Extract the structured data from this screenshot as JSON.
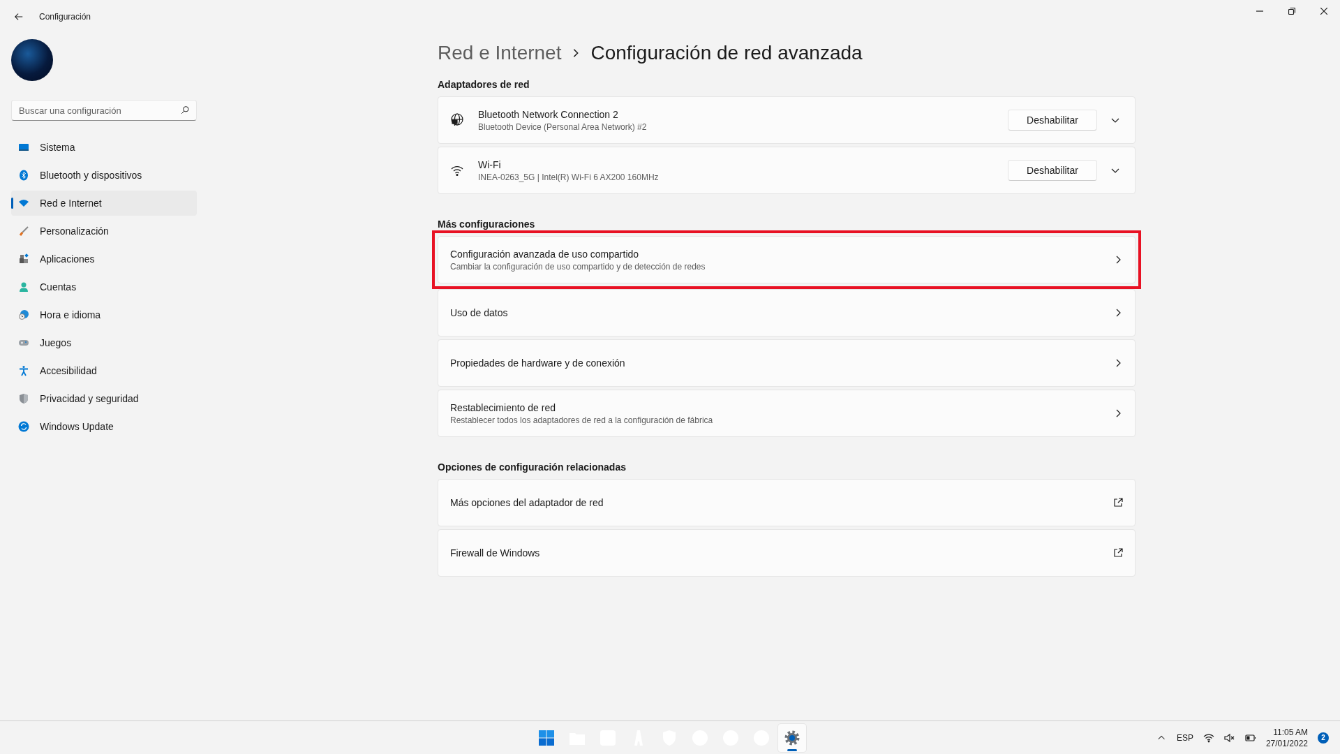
{
  "window": {
    "title": "Configuración"
  },
  "search": {
    "placeholder": "Buscar una configuración"
  },
  "nav": [
    {
      "kind": "system",
      "label": "Sistema",
      "selected": false
    },
    {
      "kind": "bluetooth",
      "label": "Bluetooth y dispositivos",
      "selected": false
    },
    {
      "kind": "network",
      "label": "Red e Internet",
      "selected": true
    },
    {
      "kind": "brush",
      "label": "Personalización",
      "selected": false
    },
    {
      "kind": "apps",
      "label": "Aplicaciones",
      "selected": false
    },
    {
      "kind": "accounts",
      "label": "Cuentas",
      "selected": false
    },
    {
      "kind": "time",
      "label": "Hora e idioma",
      "selected": false
    },
    {
      "kind": "games",
      "label": "Juegos",
      "selected": false
    },
    {
      "kind": "accessibility",
      "label": "Accesibilidad",
      "selected": false
    },
    {
      "kind": "privacy",
      "label": "Privacidad y seguridad",
      "selected": false
    },
    {
      "kind": "update",
      "label": "Windows Update",
      "selected": false
    }
  ],
  "breadcrumb": {
    "parent": "Red e Internet",
    "current": "Configuración de red avanzada"
  },
  "adapters": {
    "title": "Adaptadores de red",
    "items": [
      {
        "kind": "globe",
        "name": "Bluetooth Network Connection 2",
        "detail": "Bluetooth Device (Personal Area Network) #2",
        "button": "Deshabilitar",
        "expanded": false
      },
      {
        "kind": "wifi",
        "name": "Wi-Fi",
        "detail": "INEA-0263_5G | Intel(R) Wi-Fi 6 AX200 160MHz",
        "button": "Deshabilitar",
        "expanded": false
      }
    ]
  },
  "more": {
    "title": "Más configuraciones",
    "items": [
      {
        "kind": "link",
        "title": "Configuración avanzada de uso compartido",
        "subtitle": "Cambiar la configuración de uso compartido y de detección de redes",
        "highlighted": true
      },
      {
        "kind": "link",
        "title": "Uso de datos",
        "highlighted": false
      },
      {
        "kind": "link",
        "title": "Propiedades de hardware y de conexión",
        "highlighted": false
      },
      {
        "kind": "link",
        "title": "Restablecimiento de red",
        "subtitle": "Restablecer todos los adaptadores de red a la configuración de fábrica",
        "highlighted": false
      }
    ]
  },
  "related": {
    "title": "Opciones de configuración relacionadas",
    "items": [
      {
        "kind": "external",
        "title": "Más opciones del adaptador de red",
        "highlighted": false
      },
      {
        "kind": "external",
        "title": "Firewall de Windows",
        "highlighted": false
      }
    ]
  },
  "taskbar": {
    "apps": [
      {
        "kind": "start",
        "selected": false
      },
      {
        "kind": "files",
        "selected": false
      },
      {
        "kind": "square",
        "selected": false
      },
      {
        "kind": "letter",
        "selected": false
      },
      {
        "kind": "shield",
        "selected": false
      },
      {
        "kind": "circle",
        "selected": false
      },
      {
        "kind": "circle",
        "selected": false
      },
      {
        "kind": "circle",
        "selected": false
      },
      {
        "kind": "settings",
        "selected": true
      }
    ],
    "language": "ESP",
    "time": "11:05 AM",
    "date": "27/01/2022",
    "notifications": "2"
  }
}
